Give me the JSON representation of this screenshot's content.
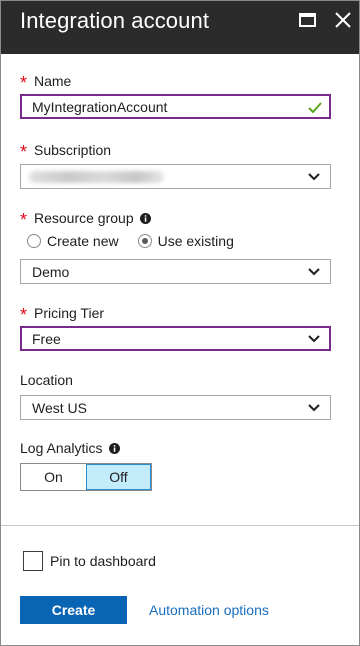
{
  "header": {
    "title": "Integration account"
  },
  "form": {
    "name": {
      "label": "Name",
      "value": "MyIntegrationAccount",
      "required": true
    },
    "subscription": {
      "label": "Subscription",
      "value": "",
      "required": true
    },
    "resource_group": {
      "label": "Resource group",
      "required": true,
      "options": [
        "Create new",
        "Use existing"
      ],
      "selected_option": "Use existing",
      "value": "Demo"
    },
    "pricing_tier": {
      "label": "Pricing Tier",
      "value": "Free",
      "required": true
    },
    "location": {
      "label": "Location",
      "value": "West US"
    },
    "log_analytics": {
      "label": "Log Analytics",
      "options": [
        "On",
        "Off"
      ],
      "selected": "Off"
    }
  },
  "footer": {
    "pin_label": "Pin to dashboard",
    "pin_checked": false,
    "create_label": "Create",
    "automation_label": "Automation options"
  },
  "colors": {
    "titlebar_bg": "#2b2b2b",
    "required_star": "#e00b1c",
    "focus_border": "#7a2a8c",
    "valid_check": "#5aa61e",
    "primary_button": "#0a64b4",
    "link": "#1a6fbf",
    "toggle_active_bg": "#c3ecfb"
  },
  "icons": {
    "maximize": "maximize-icon",
    "close": "close-icon",
    "dropdown": "chevron-down-icon",
    "valid": "checkmark-icon",
    "info": "info-icon"
  }
}
